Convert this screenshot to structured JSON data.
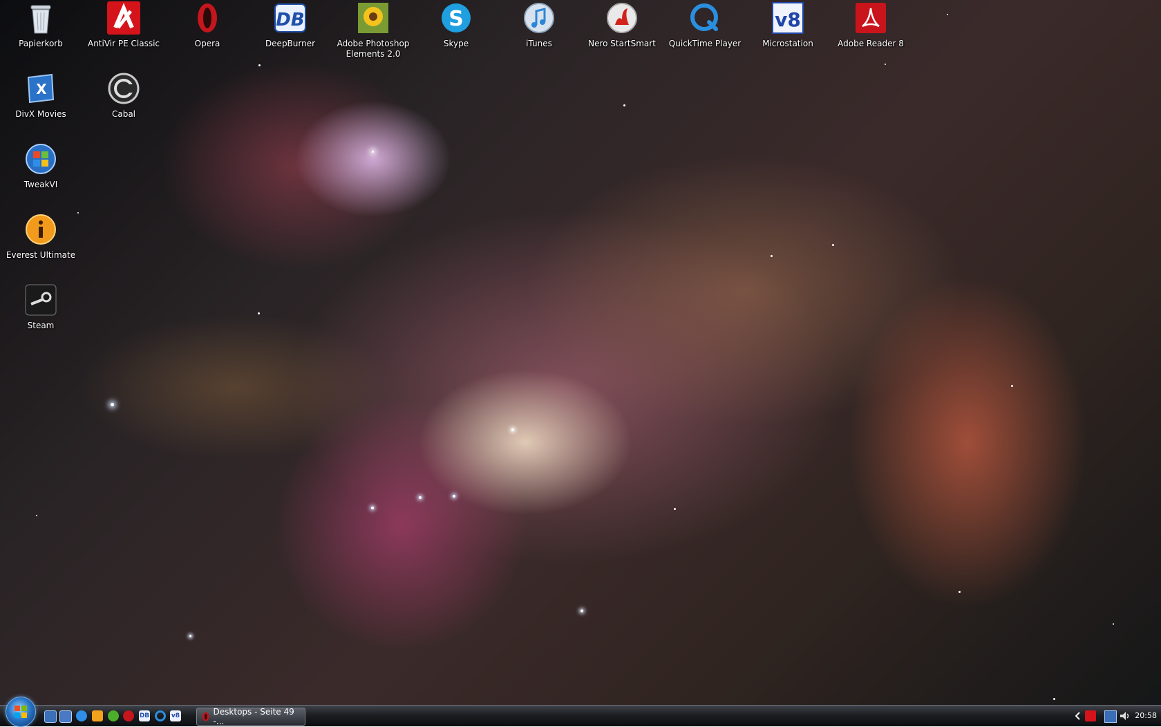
{
  "desktop": {
    "icons": [
      {
        "label": "Papierkorb",
        "icon": "recycle-bin-icon"
      },
      {
        "label": "AntiVir PE Classic",
        "icon": "antivir-icon"
      },
      {
        "label": "Opera",
        "icon": "opera-icon"
      },
      {
        "label": "DeepBurner",
        "icon": "deepburner-icon"
      },
      {
        "label": "Adobe Photoshop Elements 2.0",
        "icon": "photoshop-elements-icon"
      },
      {
        "label": "Skype",
        "icon": "skype-icon"
      },
      {
        "label": "iTunes",
        "icon": "itunes-icon"
      },
      {
        "label": "Nero StartSmart",
        "icon": "nero-icon"
      },
      {
        "label": "QuickTime Player",
        "icon": "quicktime-icon"
      },
      {
        "label": "Microstation",
        "icon": "microstation-icon"
      },
      {
        "label": "Adobe Reader 8",
        "icon": "adobe-reader-icon"
      },
      {
        "label": "DivX Movies",
        "icon": "divx-icon"
      },
      {
        "label": "Cabal",
        "icon": "cabal-icon"
      },
      {
        "label": "TweakVI",
        "icon": "tweakvi-icon"
      },
      {
        "label": "Everest Ultimate",
        "icon": "everest-icon"
      },
      {
        "label": "Steam",
        "icon": "steam-icon"
      }
    ]
  },
  "taskbar": {
    "task_button_label": "Desktops - Seite 49 -...",
    "clock": "20:58",
    "ql_icon_text": {
      "deepburner": "DB",
      "microstation": "v8"
    }
  },
  "colors": {
    "antivir": "#d4141a",
    "opera": "#c4161c",
    "deepburner": "#1f4fa8",
    "skype": "#1f9ee0",
    "adobe_reader": "#c8141a",
    "microstation": "#2046a8",
    "quicktime": "#2b8fe0"
  }
}
